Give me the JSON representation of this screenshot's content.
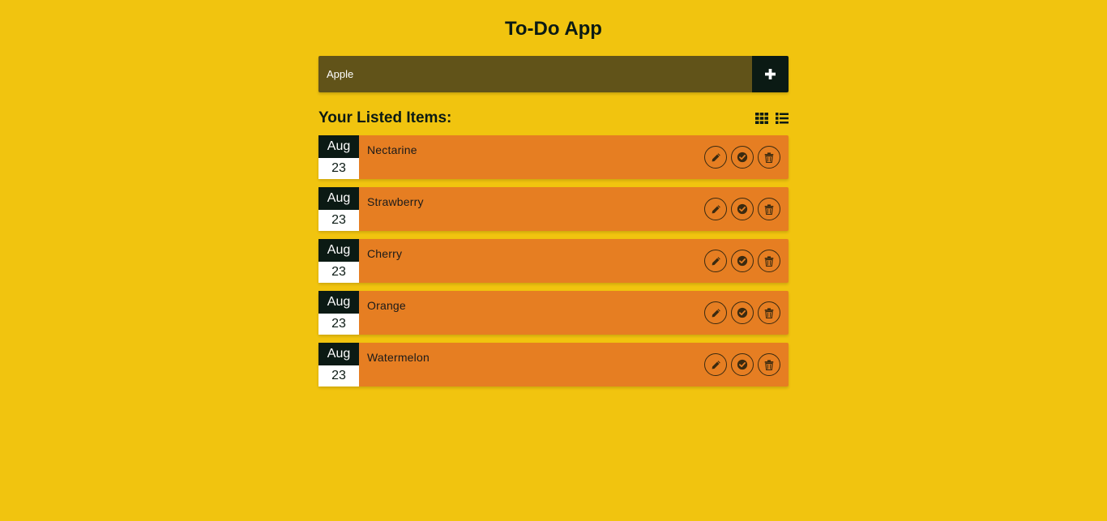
{
  "app": {
    "title": "To-Do App"
  },
  "input": {
    "value": "Apple",
    "placeholder": "",
    "add_icon": "plus-icon"
  },
  "list": {
    "heading": "Your Listed Items:",
    "view_icons": [
      "grid-icon",
      "list-icon"
    ],
    "items": [
      {
        "month": "Aug",
        "day": "23",
        "text": "Nectarine"
      },
      {
        "month": "Aug",
        "day": "23",
        "text": "Strawberry"
      },
      {
        "month": "Aug",
        "day": "23",
        "text": "Cherry"
      },
      {
        "month": "Aug",
        "day": "23",
        "text": "Orange"
      },
      {
        "month": "Aug",
        "day": "23",
        "text": "Watermelon"
      }
    ],
    "item_action_icons": [
      "pencil-icon",
      "check-circle-icon",
      "trash-icon"
    ]
  },
  "colors": {
    "background": "#f1c40f",
    "input_bg": "#615319",
    "dark": "#0b1a14",
    "item_bg": "#e67e22",
    "date_day_bg": "#ffffff"
  }
}
